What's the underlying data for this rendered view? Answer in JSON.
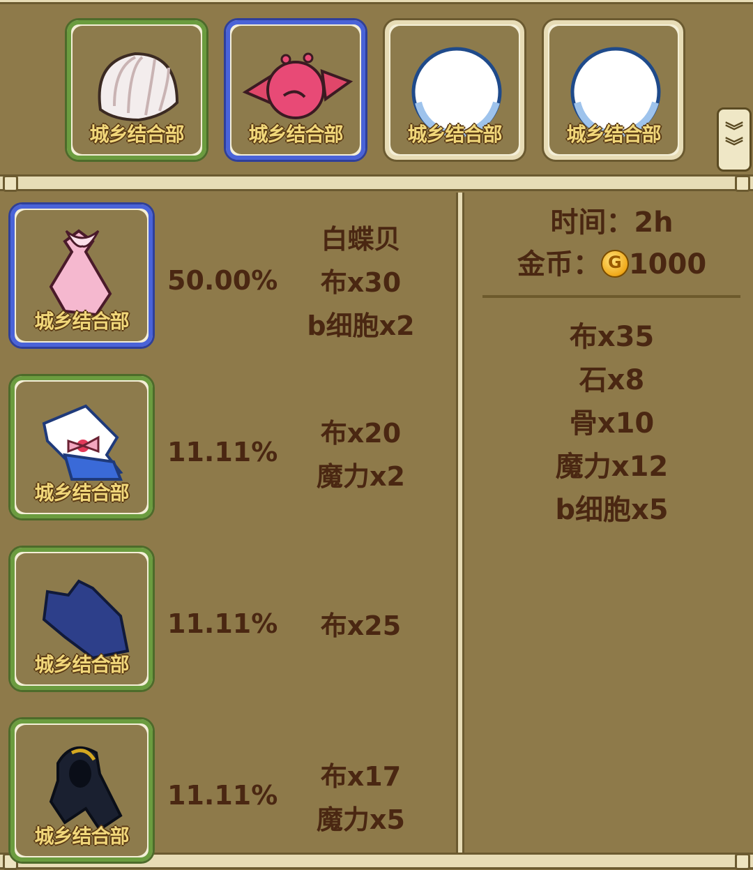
{
  "top_tabs": [
    {
      "item": "shell-icon",
      "frame": "green",
      "watermark": "城乡结合部"
    },
    {
      "item": "pink-bat-icon",
      "frame": "blue",
      "watermark": "城乡结合部"
    },
    {
      "item": "snowball-icon",
      "frame": "cream",
      "watermark": "城乡结合部"
    },
    {
      "item": "snowball-icon",
      "frame": "cream",
      "watermark": "城乡结合部"
    }
  ],
  "recipes": [
    {
      "item": "pink-dress-icon",
      "frame": "blue",
      "watermark": "城乡结合部",
      "chance": "50.00%",
      "materials": [
        "白蝶贝",
        "布x30",
        "b细胞x2"
      ]
    },
    {
      "item": "sailor-outfit-icon",
      "frame": "green",
      "watermark": "城乡结合部",
      "chance": "11.11%",
      "materials": [
        "布x20",
        "魔力x2"
      ]
    },
    {
      "item": "blue-swimsuit-icon",
      "frame": "green",
      "watermark": "城乡结合部",
      "chance": "11.11%",
      "materials": [
        "布x25"
      ]
    },
    {
      "item": "dark-hood-icon",
      "frame": "green",
      "watermark": "城乡结合部",
      "chance": "11.11%",
      "materials": [
        "布x17",
        "魔力x5"
      ]
    }
  ],
  "info": {
    "time_label": "时间：2h",
    "gold_label": "金币：",
    "gold_value": "1000",
    "requirements": [
      "布x35",
      "石x8",
      "骨x10",
      "魔力x12",
      "b细胞x5"
    ]
  },
  "colors": {
    "background": "#8e7a4a",
    "text": "#4a2712",
    "frame_green": "#6b9c3f",
    "frame_blue": "#4a63d8",
    "frame_cream": "#e7dcb6"
  }
}
